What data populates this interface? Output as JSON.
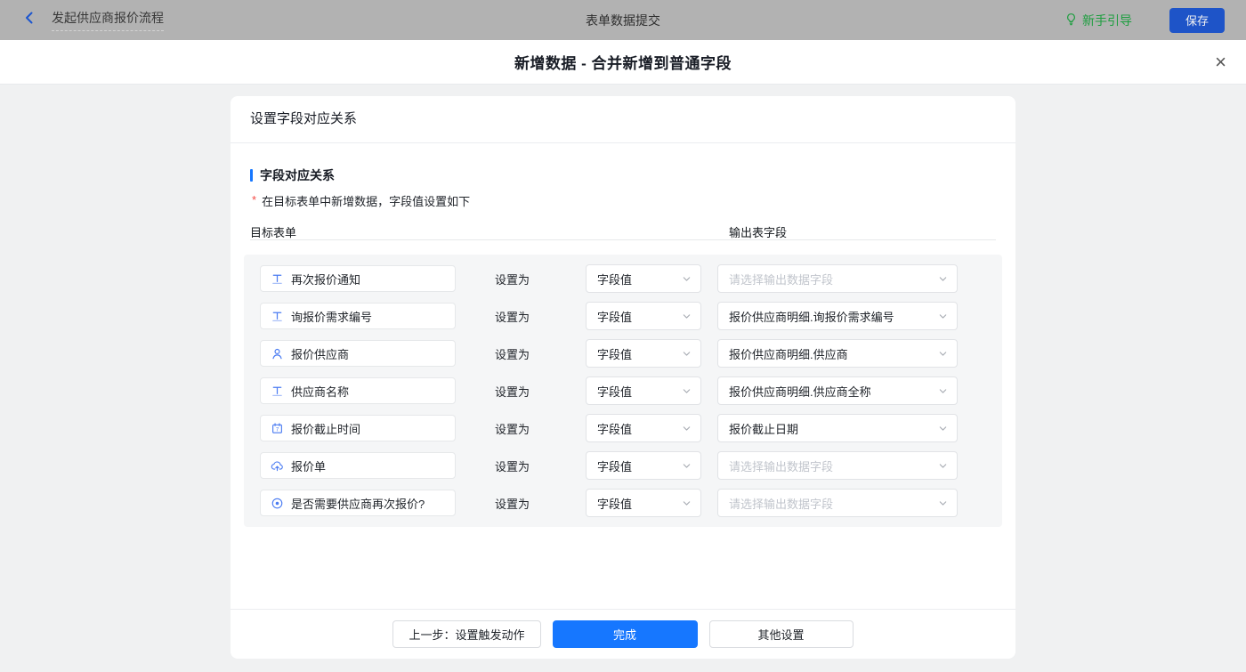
{
  "topbar": {
    "flow_title": "发起供应商报价流程",
    "center_title": "表单数据提交",
    "guide_label": "新手引导",
    "save_label": "保存"
  },
  "modal": {
    "title": "新增数据 - 合并新增到普通字段",
    "close_glyph": "×"
  },
  "card": {
    "header": "设置字段对应关系",
    "section_title": "字段对应关系",
    "required_mark": "*",
    "description": "在目标表单中新增数据，字段值设置如下",
    "col_left": "目标表单",
    "col_right": "输出表字段",
    "set_as_label": "设置为",
    "output_placeholder": "请选择输出数据字段",
    "rows": [
      {
        "icon": "text-field-icon",
        "field": "再次报价通知",
        "mode": "字段值",
        "output_value": "",
        "output_placeholder": "请选择输出数据字段"
      },
      {
        "icon": "text-field-icon",
        "field": "询报价需求编号",
        "mode": "字段值",
        "output_value": "报价供应商明细.询报价需求编号"
      },
      {
        "icon": "member-icon",
        "field": "报价供应商",
        "mode": "字段值",
        "output_value": "报价供应商明细.供应商"
      },
      {
        "icon": "text-field-icon",
        "field": "供应商名称",
        "mode": "字段值",
        "output_value": "报价供应商明细.供应商全称"
      },
      {
        "icon": "calendar-icon",
        "field": "报价截止时间",
        "mode": "字段值",
        "output_value": "报价截止日期"
      },
      {
        "icon": "upload-icon",
        "field": "报价单",
        "mode": "字段值",
        "output_value": "",
        "output_placeholder": "请选择输出数据字段"
      },
      {
        "icon": "radio-icon",
        "field": "是否需要供应商再次报价?",
        "mode": "字段值",
        "output_value": "",
        "output_placeholder": "请选择输出数据字段"
      }
    ],
    "footer": {
      "prev_label": "上一步：设置触发动作",
      "done_label": "完成",
      "other_label": "其他设置"
    }
  },
  "colors": {
    "topbar_bg": "#b2b2b2",
    "accent_blue": "#1677ff",
    "save_btn_bg": "#1e54c8",
    "guide_green": "#1d9e3f",
    "field_icon_blue": "#4a7bf2",
    "required_red": "#f54a45",
    "panel_bg": "#f5f6f7",
    "placeholder_gray": "#c1c5cc"
  }
}
